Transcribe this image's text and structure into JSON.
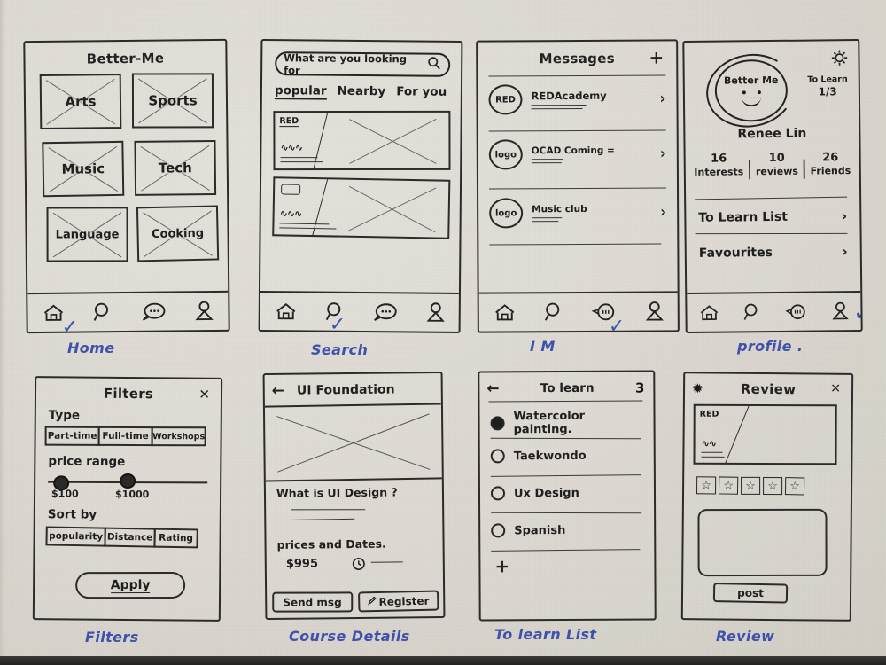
{
  "meta": {
    "ink_color": "#232323",
    "annotation_color": "#3f51ab",
    "paper_color": "#dedad2"
  },
  "screens": [
    {
      "id": "home",
      "caption": "Home",
      "title": "Better-Me",
      "tiles": [
        {
          "label": "Arts"
        },
        {
          "label": "Sports"
        },
        {
          "label": "Music"
        },
        {
          "label": "Tech"
        },
        {
          "label": "Language"
        },
        {
          "label": "Cooking"
        }
      ],
      "nav": {
        "items": [
          "home-icon",
          "search-icon",
          "chat-icon",
          "person-icon"
        ],
        "active_index": 0,
        "check_mark": "✓"
      }
    },
    {
      "id": "search",
      "caption": "Search",
      "search": {
        "placeholder": "What are you looking for",
        "icon": "search-icon"
      },
      "tabs": [
        {
          "label": "popular",
          "active": true
        },
        {
          "label": "Nearby",
          "active": false
        },
        {
          "label": "For you",
          "active": false
        }
      ],
      "cards": [
        {
          "label": "RED"
        },
        {
          "label": ""
        }
      ],
      "nav": {
        "items": [
          "home-icon",
          "search-icon",
          "chat-icon",
          "person-icon"
        ],
        "active_index": 1,
        "check_mark": "✓"
      }
    },
    {
      "id": "im",
      "caption": "I M",
      "title": "Messages",
      "add_label": "+",
      "threads": [
        {
          "avatar": "RED",
          "name": "REDAcademy",
          "chevron": "›"
        },
        {
          "avatar": "logo",
          "name": "OCAD Coming =",
          "chevron": "›"
        },
        {
          "avatar": "logo",
          "name": "Music club",
          "chevron": "›"
        }
      ],
      "nav": {
        "items": [
          "home-icon",
          "search-icon",
          "chat-icon",
          "person-icon"
        ],
        "active_index": 2,
        "check_mark": "✓"
      }
    },
    {
      "id": "profile",
      "caption": "profile .",
      "settings_icon": "gear-icon",
      "avatar_label": "Better Me",
      "badge": {
        "label": "To Learn",
        "value": "1/3"
      },
      "user_name": "Renee Lin",
      "stats": [
        {
          "value": "16",
          "label": "Interests"
        },
        {
          "value": "10",
          "label": "reviews"
        },
        {
          "value": "26",
          "label": "Friends"
        }
      ],
      "links": [
        {
          "label": "To Learn List",
          "chevron": "›"
        },
        {
          "label": "Favourites",
          "chevron": "›"
        }
      ],
      "nav": {
        "items": [
          "home-icon",
          "search-icon",
          "chat-icon",
          "person-icon"
        ],
        "active_index": 3,
        "check_mark": "✓"
      }
    },
    {
      "id": "filters",
      "caption": "Filters",
      "title": "Filters",
      "close_label": "✕",
      "type": {
        "label": "Type",
        "options": [
          "Part-time",
          "Full-time",
          "Workshops"
        ]
      },
      "price_range": {
        "label": "price range",
        "min_label": "$100",
        "max_label": "$1000",
        "min_pos_pct": 4,
        "max_pos_pct": 45
      },
      "sort_by": {
        "label": "Sort by",
        "options": [
          "popularity",
          "Distance",
          "Rating"
        ]
      },
      "apply_label": "Apply"
    },
    {
      "id": "course-details",
      "caption": "Course Details",
      "back_label": "←",
      "title": "UI Foundation",
      "section_heading": "What is UI Design ?",
      "prices_heading": "prices and Dates.",
      "price": "$995",
      "clock_icon": "clock-icon",
      "buttons": [
        {
          "label": "Send msg"
        },
        {
          "label": "Register",
          "icon": "pen-icon"
        }
      ]
    },
    {
      "id": "to-learn-list",
      "caption": "To learn List",
      "back_label": "←",
      "title": "To learn",
      "count": "3",
      "items": [
        {
          "label": "Watercolor painting.",
          "checked": true
        },
        {
          "label": "Taekwondo",
          "checked": false
        },
        {
          "label": "Ux Design",
          "checked": false
        },
        {
          "label": "Spanish",
          "checked": false
        }
      ],
      "add_label": "+"
    },
    {
      "id": "review",
      "caption": "Review",
      "title": "Review",
      "close_label": "✕",
      "menu_icon": "asterisk-icon",
      "image_label": "RED",
      "stars": {
        "count": 5,
        "glyph": "☆"
      },
      "comment_placeholder": "",
      "post_label": "post"
    }
  ]
}
